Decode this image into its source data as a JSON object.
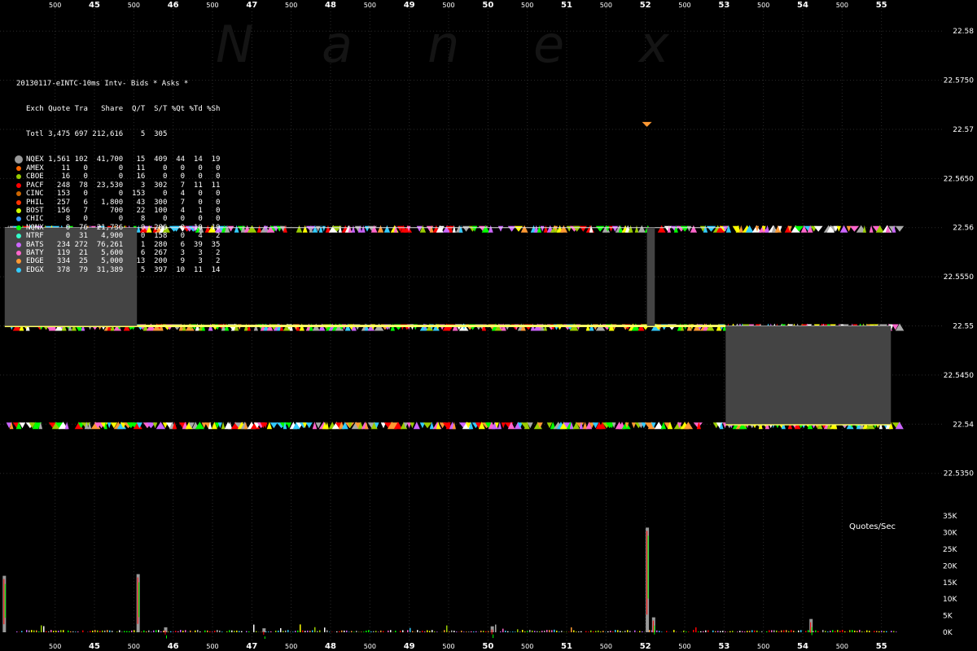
{
  "watermark": [
    "N",
    "a",
    "n",
    "e",
    "x"
  ],
  "stats": {
    "title": "20130117-eINTC-10ms Intv- Bids * Asks *",
    "header": [
      "Exch",
      "Quote",
      "Tra",
      "Share",
      "Q/T",
      "S/T",
      "%Qt",
      "%Td",
      "%Sh"
    ],
    "total": [
      "Totl",
      "3,475",
      "697",
      "212,616",
      "5",
      "305",
      "",
      "",
      ""
    ],
    "rows": [
      {
        "exch": "NQEX",
        "quote": "1,561",
        "tra": "102",
        "share": "41,700",
        "qt": "15",
        "st": "409",
        "pqt": "44",
        "ptd": "14",
        "psh": "19",
        "color": "#999999"
      },
      {
        "exch": "AMEX",
        "quote": "11",
        "tra": "0",
        "share": "0",
        "qt": "11",
        "st": "0",
        "pqt": "0",
        "ptd": "0",
        "psh": "0",
        "color": "#ff6600"
      },
      {
        "exch": "CBOE",
        "quote": "16",
        "tra": "0",
        "share": "0",
        "qt": "16",
        "st": "0",
        "pqt": "0",
        "ptd": "0",
        "psh": "0",
        "color": "#99cc00"
      },
      {
        "exch": "PACF",
        "quote": "248",
        "tra": "78",
        "share": "23,530",
        "qt": "3",
        "st": "302",
        "pqt": "7",
        "ptd": "11",
        "psh": "11",
        "color": "#ff0000"
      },
      {
        "exch": "CINC",
        "quote": "153",
        "tra": "0",
        "share": "0",
        "qt": "153",
        "st": "0",
        "pqt": "4",
        "ptd": "0",
        "psh": "0",
        "color": "#cc6600"
      },
      {
        "exch": "PHIL",
        "quote": "257",
        "tra": "6",
        "share": "1,800",
        "qt": "43",
        "st": "300",
        "pqt": "7",
        "ptd": "0",
        "psh": "0",
        "color": "#ff3300"
      },
      {
        "exch": "BOST",
        "quote": "156",
        "tra": "7",
        "share": "700",
        "qt": "22",
        "st": "100",
        "pqt": "4",
        "ptd": "1",
        "psh": "0",
        "color": "#ccff00"
      },
      {
        "exch": "CHIC",
        "quote": "8",
        "tra": "0",
        "share": "0",
        "qt": "8",
        "st": "0",
        "pqt": "0",
        "ptd": "0",
        "psh": "0",
        "color": "#3399ff"
      },
      {
        "exch": "NQNX",
        "quote": "0",
        "tra": "76",
        "share": "21,736",
        "qt": "0",
        "st": "286",
        "pqt": "0",
        "ptd": "10",
        "psh": "10",
        "color": "#00ff00"
      },
      {
        "exch": "NTRF",
        "quote": "0",
        "tra": "31",
        "share": "4,900",
        "qt": "0",
        "st": "158",
        "pqt": "0",
        "ptd": "4",
        "psh": "2",
        "color": "#33ffcc"
      },
      {
        "exch": "BATS",
        "quote": "234",
        "tra": "272",
        "share": "76,261",
        "qt": "1",
        "st": "280",
        "pqt": "6",
        "ptd": "39",
        "psh": "35",
        "color": "#cc66ff"
      },
      {
        "exch": "BATY",
        "quote": "119",
        "tra": "21",
        "share": "5,600",
        "qt": "6",
        "st": "267",
        "pqt": "3",
        "ptd": "3",
        "psh": "2",
        "color": "#ff66cc"
      },
      {
        "exch": "EDGE",
        "quote": "334",
        "tra": "25",
        "share": "5,000",
        "qt": "13",
        "st": "200",
        "pqt": "9",
        "ptd": "3",
        "psh": "2",
        "color": "#ff9933"
      },
      {
        "exch": "EDGX",
        "quote": "378",
        "tra": "79",
        "share": "31,389",
        "qt": "5",
        "st": "397",
        "pqt": "10",
        "ptd": "11",
        "psh": "14",
        "color": "#33ccff"
      }
    ]
  },
  "qps_label": "Quotes/Sec",
  "chart_data": {
    "type": "scatter",
    "x_ticks": [
      {
        "x": 44.5,
        "label": "500"
      },
      {
        "x": 45,
        "label": "45"
      },
      {
        "x": 45.5,
        "label": "500"
      },
      {
        "x": 46,
        "label": "46"
      },
      {
        "x": 46.5,
        "label": "500"
      },
      {
        "x": 47,
        "label": "47"
      },
      {
        "x": 47.5,
        "label": "500"
      },
      {
        "x": 48,
        "label": "48"
      },
      {
        "x": 48.5,
        "label": "500"
      },
      {
        "x": 49,
        "label": "49"
      },
      {
        "x": 49.5,
        "label": "500"
      },
      {
        "x": 50,
        "label": "50"
      },
      {
        "x": 50.5,
        "label": "500"
      },
      {
        "x": 51,
        "label": "51"
      },
      {
        "x": 51.5,
        "label": "500"
      },
      {
        "x": 52,
        "label": "52"
      },
      {
        "x": 52.5,
        "label": "500"
      },
      {
        "x": 53,
        "label": "53"
      },
      {
        "x": 53.5,
        "label": "500"
      },
      {
        "x": 54,
        "label": "54"
      },
      {
        "x": 54.5,
        "label": "500"
      },
      {
        "x": 55,
        "label": "55"
      }
    ],
    "xlim": [
      43.8,
      55.8
    ],
    "price_ticks": [
      {
        "v": 22.58,
        "label": "22.58"
      },
      {
        "v": 22.575,
        "label": "22.5750"
      },
      {
        "v": 22.57,
        "label": "22.57"
      },
      {
        "v": 22.565,
        "label": "22.5650"
      },
      {
        "v": 22.56,
        "label": "22.56"
      },
      {
        "v": 22.555,
        "label": "22.5550"
      },
      {
        "v": 22.55,
        "label": "22.55"
      },
      {
        "v": 22.545,
        "label": "22.5450"
      },
      {
        "v": 22.54,
        "label": "22.54"
      },
      {
        "v": 22.535,
        "label": "22.5350"
      }
    ],
    "ylim": [
      22.531,
      22.5825
    ],
    "volume_ticks": [
      {
        "v": 35000,
        "label": "35K"
      },
      {
        "v": 30000,
        "label": "30K"
      },
      {
        "v": 25000,
        "label": "25K"
      },
      {
        "v": 20000,
        "label": "20K"
      },
      {
        "v": 15000,
        "label": "15K"
      },
      {
        "v": 10000,
        "label": "10K"
      },
      {
        "v": 5000,
        "label": "5K"
      },
      {
        "v": 0,
        "label": "0K"
      }
    ],
    "volume_ylim": [
      0,
      36000
    ],
    "nbbo_segments": [
      {
        "x0": 43.86,
        "x1": 45.54,
        "bid": 22.55,
        "ask": 22.56
      },
      {
        "x0": 45.54,
        "x1": 52.02,
        "bid": 22.55,
        "ask": 22.56
      },
      {
        "x0": 52.02,
        "x1": 52.12,
        "bid": 22.55,
        "ask": 22.56
      },
      {
        "x0": 52.12,
        "x1": 53.02,
        "bid": 22.55,
        "ask": 22.56
      },
      {
        "x0": 53.02,
        "x1": 55.12,
        "bid": 22.54,
        "ask": 22.55
      }
    ],
    "locked_ranges": [
      {
        "x0": 43.86,
        "x1": 45.54,
        "low": 22.55,
        "high": 22.56
      },
      {
        "x0": 52.02,
        "x1": 52.12,
        "low": 22.55,
        "high": 22.56
      },
      {
        "x0": 53.02,
        "x1": 55.12,
        "low": 22.54,
        "high": 22.55
      }
    ],
    "quote_bands": [
      {
        "x0": 43.88,
        "x1": 55.2,
        "price": 22.56,
        "density": 0.75
      },
      {
        "x0": 43.88,
        "x1": 55.2,
        "price": 22.55,
        "density": 0.8
      },
      {
        "x0": 43.88,
        "x1": 55.2,
        "price": 22.54,
        "density": 0.85
      }
    ],
    "volume_spikes": [
      {
        "x": 43.85,
        "v": 17000
      },
      {
        "x": 45.55,
        "v": 17500
      },
      {
        "x": 52.02,
        "v": 31500
      },
      {
        "x": 52.1,
        "v": 4500
      },
      {
        "x": 54.1,
        "v": 4000
      },
      {
        "x": 50.05,
        "v": 1800
      },
      {
        "x": 45.9,
        "v": 1500
      },
      {
        "x": 47.15,
        "v": 1200
      }
    ],
    "marker_at": {
      "x": 52.02,
      "price": 22.5705
    }
  }
}
